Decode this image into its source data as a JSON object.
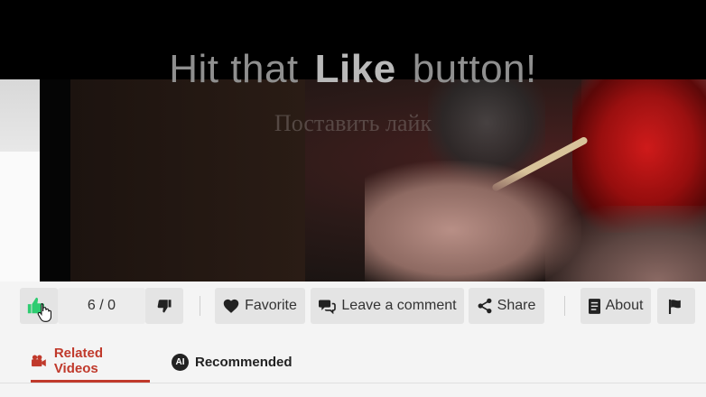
{
  "overlay": {
    "title_left": "Hit that",
    "title_bold": "Like",
    "title_right": "button!",
    "subtitle": "Поставить лайк"
  },
  "toolbar": {
    "vote_count": "6 / 0",
    "favorite_label": "Favorite",
    "comment_label": "Leave a comment",
    "share_label": "Share",
    "about_label": "About"
  },
  "tabs": {
    "related_label": "Related Videos",
    "recommended_label": "Recommended",
    "ai_badge": "AI"
  },
  "colors": {
    "accent": "#c0392b",
    "like_green": "#2ecc71",
    "button_bg": "#e4e4e4"
  },
  "icons": [
    "thumbs-up-icon",
    "cursor-hand-icon",
    "thumbs-down-icon",
    "heart-icon",
    "comment-icon",
    "share-icon",
    "document-icon",
    "flag-icon",
    "video-camera-icon"
  ]
}
